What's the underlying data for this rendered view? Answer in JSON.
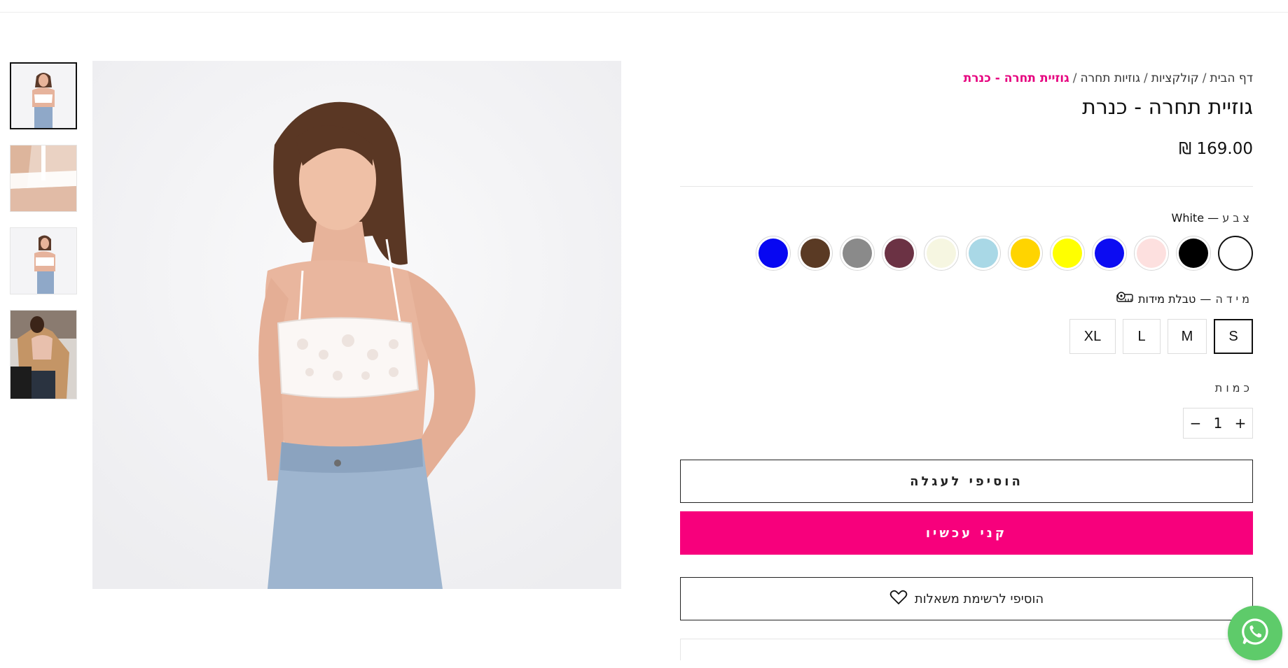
{
  "breadcrumb": {
    "home": "דף הבית",
    "collections": "קולקציות",
    "category": "גוזיות תחרה",
    "current": "גוזיית תחרה - כנרת",
    "separator": "/"
  },
  "product": {
    "title": "גוזיית תחרה - כנרת",
    "price": "169.00",
    "currency": "₪"
  },
  "color": {
    "label": "צבע",
    "dash": "—",
    "selected": "White",
    "swatches": [
      {
        "name": "White",
        "color": "#ffffff"
      },
      {
        "name": "Black",
        "color": "#000000"
      },
      {
        "name": "Pink",
        "color": "#fde0df"
      },
      {
        "name": "Blue",
        "color": "#0c0cf2"
      },
      {
        "name": "Yellow",
        "color": "#ffff00"
      },
      {
        "name": "Gold",
        "color": "#ffd400"
      },
      {
        "name": "Light Blue",
        "color": "#a9d8e6"
      },
      {
        "name": "Cream",
        "color": "#f6f6e1"
      },
      {
        "name": "Plum Pattern",
        "color": "#6b3244"
      },
      {
        "name": "Grey Pattern",
        "color": "#8a8a8a"
      },
      {
        "name": "Leopard",
        "color": "#5a3a24"
      },
      {
        "name": "Royal Blue",
        "color": "#0707f2"
      }
    ]
  },
  "size": {
    "label": "מידה",
    "dash": "—",
    "chart_link": "טבלת מידות",
    "options": [
      "S",
      "M",
      "L",
      "XL"
    ],
    "selected": "S"
  },
  "quantity": {
    "label": "כמות",
    "value": "1",
    "minus": "−",
    "plus": "+"
  },
  "buttons": {
    "add_to_cart": "הוסיפי לעגלה",
    "buy_now": "קני עכשיו",
    "wishlist": "הוסיפי לרשימת משאלות"
  },
  "colors": {
    "accent": "#f7007c",
    "whatsapp": "#5ecb6a"
  }
}
